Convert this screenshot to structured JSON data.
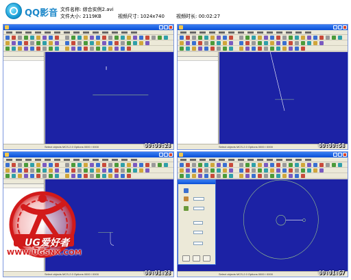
{
  "header": {
    "app_name": "QQ影音",
    "file_name_label": "文件名称:",
    "file_name": "综合实例2.avi",
    "file_size_label": "文件大小:",
    "file_size": "2119KB",
    "resolution_label": "视频尺寸:",
    "resolution": "1024x740",
    "duration_label": "视频时长:",
    "duration": "00:02:27"
  },
  "thumbnails": [
    {
      "timecode": "00:00:28",
      "status": "Select objects  MCS-2.0  Options 0000 / 0000"
    },
    {
      "timecode": "00:00:58",
      "status": "Select objects  MCS-2.0  Options 0000 / 0000"
    },
    {
      "timecode": "00:01:28",
      "status": "Select objects  MCS-2.0  Options 0000 / 0000"
    },
    {
      "timecode": "00:01:57",
      "status": "Select objects  MCS-2.0  Options 0000 / 0000"
    }
  ],
  "watermark": {
    "brand": "UG爱好者",
    "site": "WWW.UGSNX.COM"
  },
  "colors": {
    "canvas": "#1c22a5",
    "geometry": "#9ec98a",
    "titlebar": "#0a4fd6",
    "watermark_red": "#d21a1a"
  }
}
